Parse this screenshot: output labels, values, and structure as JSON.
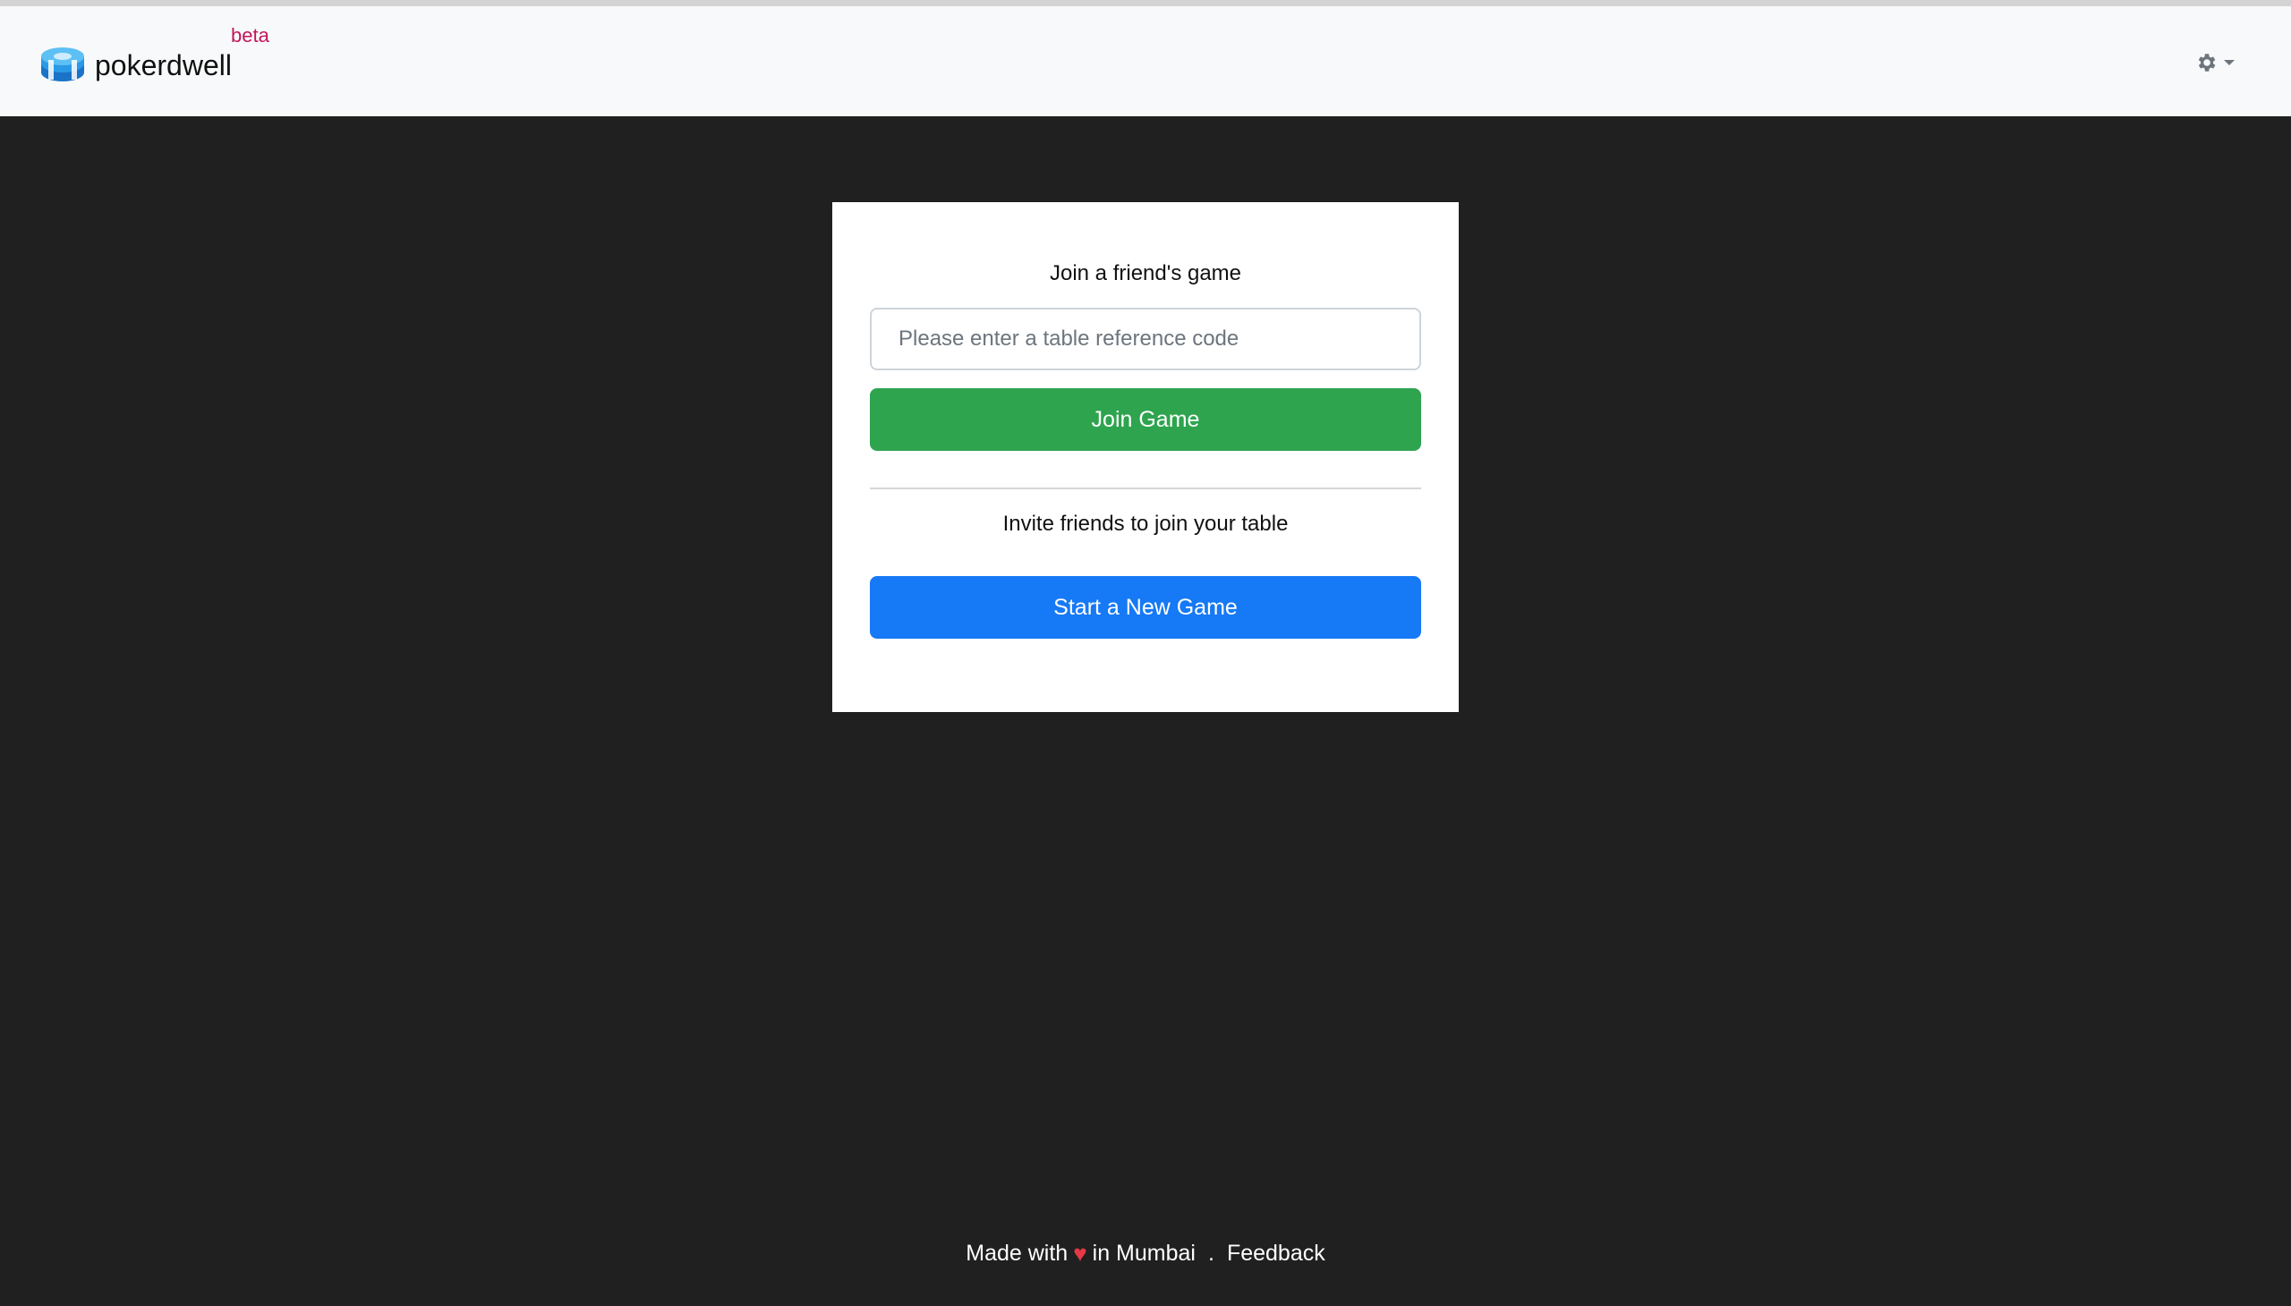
{
  "header": {
    "brand_name": "pokerdwell",
    "beta_label": "beta",
    "settings_icon": "gear-icon",
    "dropdown_icon": "caret-down-icon"
  },
  "card": {
    "join_title": "Join a friend's game",
    "ref_placeholder": "Please enter a table reference code",
    "join_button": "Join Game",
    "invite_title": "Invite friends to join your table",
    "start_button": "Start a New Game"
  },
  "footer": {
    "made_with": "Made with",
    "heart": "♥",
    "location": "in Mumbai",
    "separator": ".",
    "feedback": "Feedback"
  },
  "colors": {
    "join_button": "#2ea44f",
    "start_button": "#1679f5",
    "background": "#202020",
    "beta": "#c2185b"
  }
}
